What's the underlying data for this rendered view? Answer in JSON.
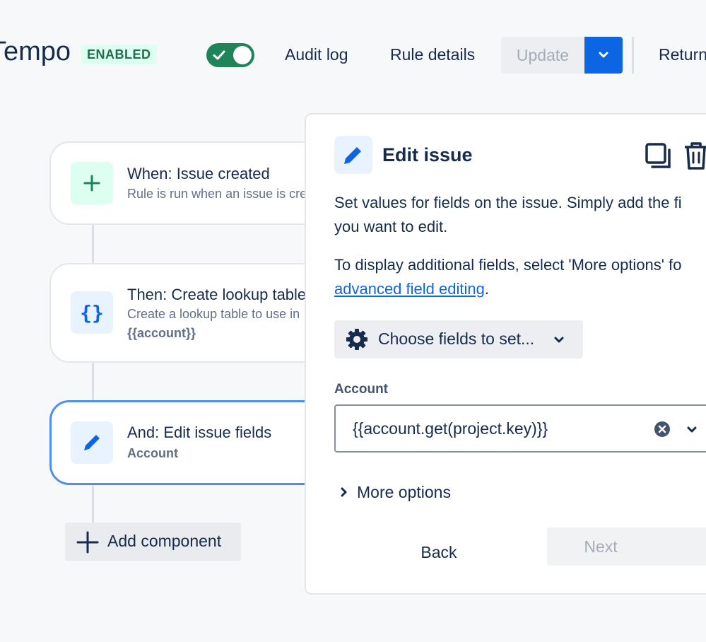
{
  "header": {
    "rule_name": "Tempo",
    "status": "ENABLED",
    "toggle_on": true,
    "audit_log": "Audit log",
    "rule_details": "Rule details",
    "update": "Update",
    "return": "Return"
  },
  "flow": {
    "trigger": {
      "title": "When: Issue created",
      "desc": "Rule is run when an issue is created"
    },
    "lookup": {
      "title": "Then: Create lookup table",
      "desc": "Create a lookup table to use in",
      "var": "{{account}}"
    },
    "edit": {
      "title": "And: Edit issue fields",
      "field": "Account"
    },
    "add_component": "Add component"
  },
  "panel": {
    "title": "Edit issue",
    "desc_line1": "Set values for fields on the issue. Simply add the fi",
    "desc_line2": "you want to edit.",
    "desc2_line1": "To display additional fields, select 'More options' fo",
    "desc2_link": "advanced field editing",
    "desc2_period": ".",
    "choose_fields": "Choose fields to set...",
    "field_label": "Account",
    "field_value": "{{account.get(project.key)}}",
    "more_options": "More options",
    "back": "Back",
    "next": "Next"
  },
  "colors": {
    "accent": "#0c66e4",
    "enabled_green": "#1f845a",
    "selected_border": "#4c8ff0"
  }
}
